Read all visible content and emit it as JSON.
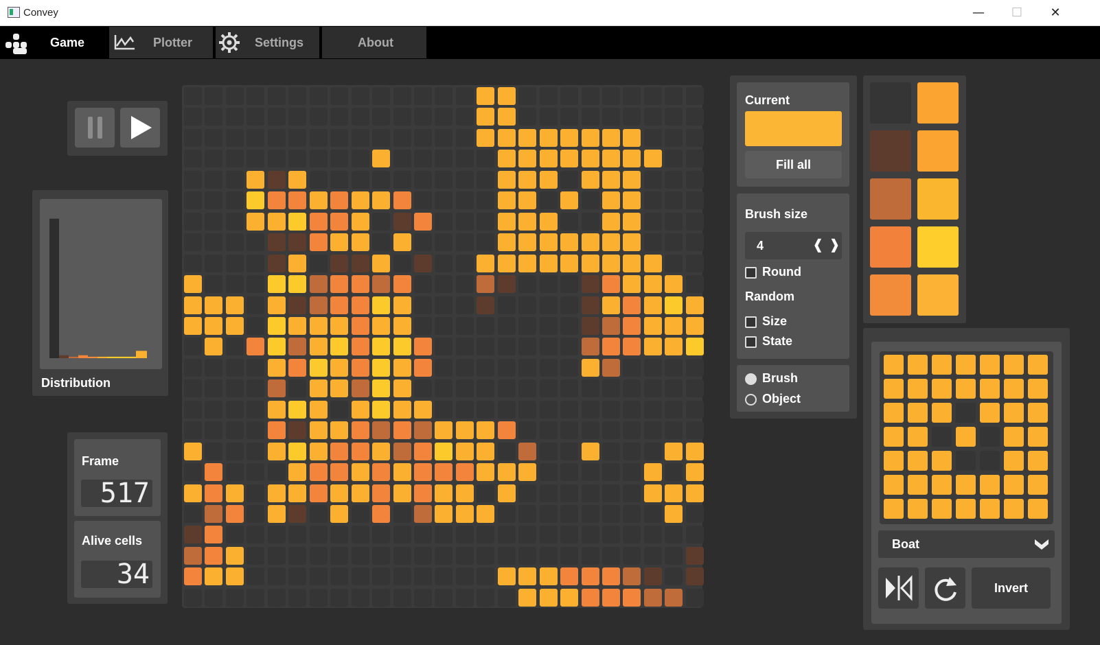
{
  "window": {
    "title": "Convey",
    "minimize": "—",
    "maximize": "☐",
    "close": "✕"
  },
  "nav": {
    "tabs": [
      {
        "label": "Game",
        "active": true
      },
      {
        "label": "Plotter",
        "active": false
      },
      {
        "label": "Settings",
        "active": false
      },
      {
        "label": "About",
        "active": false
      }
    ]
  },
  "playback": {
    "pause_icon": "pause-icon",
    "play_icon": "play-icon"
  },
  "distribution": {
    "label": "Distribution",
    "bar_values": [
      0.95,
      0.02,
      0.01,
      0.02,
      0.01,
      0.01,
      0.01,
      0.05
    ]
  },
  "stats": {
    "frame_label": "Frame",
    "frame_value": "517",
    "alive_label": "Alive cells",
    "alive_value": "34"
  },
  "brush_panel": {
    "current_label": "Current",
    "current_color": "#fbb635",
    "fill_all_label": "Fill all",
    "brush_size_label": "Brush size",
    "brush_size_value": "4",
    "round_label": "Round",
    "random_label": "Random",
    "size_label": "Size",
    "state_label": "State",
    "mode_brush_label": "Brush",
    "mode_object_label": "Object",
    "mode_selected": "Brush"
  },
  "palette": {
    "colors": [
      "#353535",
      "#fca432",
      "#5d3c2d",
      "#fca432",
      "#bf6c3a",
      "#fbb62f",
      "#f2813b",
      "#fdce2c",
      "#f28c3b",
      "#fcb234"
    ]
  },
  "object_panel": {
    "selected_object": "Boat",
    "invert_label": "Invert",
    "preview": [
      "1111111",
      "1111111",
      "1110111",
      "1101011",
      "1110011",
      "1111111",
      "1111111"
    ]
  },
  "board": {
    "cols": 25,
    "rows": 25,
    "palette": {
      ".": "#353535",
      "d": "#5d3c2d",
      "r": "#bf6c3a",
      "o": "#f2843b",
      "a": "#fbb030",
      "y": "#fdca2c"
    },
    "rows_data": [
      "..............aa.........",
      "..............aa.........",
      "..............aaaaaaaa...",
      ".........a.....aaaaaaaa..",
      "...ada.........aaa.aaa...",
      "...yooaoaao....aa.a.aa...",
      "...aayooa.do...aaa..aa...",
      "....ddoaa.a....aaaaaaa...",
      "....da.dda.d..aaaaaaaaa..",
      "a...yyrooro...rd...doaaa.",
      "aaa.adrooya...d....daoaya",
      "aaa.yaaaoaa........droaaa",
      ".a.oyrayoyyo.......rooaay",
      "....aoyaoyao.......ar....",
      "....r.aarya..............",
      "....aya.ayaa.............",
      "....odaaororaaao.........",
      "a...ayaooaroyaa.r..a...aa",
      ".o...aooaoaoooaaa.....a.a",
      "aoa.aaoaaoaoaa.a......aaa",
      ".ro.ad.a.o.raaa........a.",
      "do.......................",
      "roa.....................d",
      "oaa............aaaooord.dr",
      "................aaaooorr.."
    ]
  }
}
